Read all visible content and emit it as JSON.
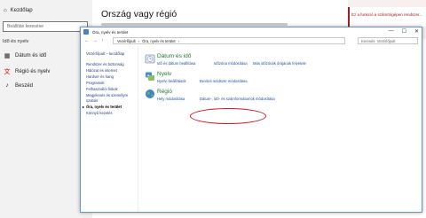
{
  "settings": {
    "home_label": "Kezdőlap",
    "search_placeholder": "Beállítás keresése",
    "section_title": "Idő és nyelv",
    "nav": [
      {
        "label": "Dátum és idő",
        "icon": "calendar-icon"
      },
      {
        "label": "Régió és nyelv",
        "icon": "language-icon"
      },
      {
        "label": "Beszéd",
        "icon": "microphone-icon"
      }
    ],
    "page_heading": "Ország vagy régió",
    "side_panel_text": "Ez a funkció a számítógépen rendszer..."
  },
  "control_panel": {
    "window_title": "Óra, nyelv és terület",
    "window_buttons": [
      "—",
      "☐",
      "✕"
    ],
    "breadcrumb": [
      "Vezérlőpult",
      "Óra, nyelv és terület"
    ],
    "search_placeholder": "Keresés: Vezérlőpult",
    "left_home": "Vezérlőpult – kezdőlap",
    "left_items": [
      "Rendszer és biztonság",
      "Hálózat és internet",
      "Hardver és hang",
      "Programok",
      "Felhasználói fiókok",
      "Megjelenés és személyre szabás",
      "Óra, nyelv és terület",
      "Könnyű kezelés"
    ],
    "current_item_index": 6,
    "categories": [
      {
        "title": "Dátum és idő",
        "icon": "clock-icon",
        "links": [
          "Idő és dátum beállítása",
          "Időzóna módosítása",
          "Más időzónák órájának felvétele"
        ]
      },
      {
        "title": "Nyelv",
        "icon": "language-icon",
        "links": [
          "Nyelvi beállítások",
          "Beviteli módszer módosítása"
        ]
      },
      {
        "title": "Régió",
        "icon": "globe-icon",
        "links": [
          "Hely módosítása",
          "Dátum-, idő- és számformátumok módosítása"
        ]
      }
    ]
  },
  "colors": {
    "link": "#1f4fa8",
    "category_title": "#1e7a2e",
    "highlight": "#d21a2a",
    "accent_red": "#c00000"
  }
}
